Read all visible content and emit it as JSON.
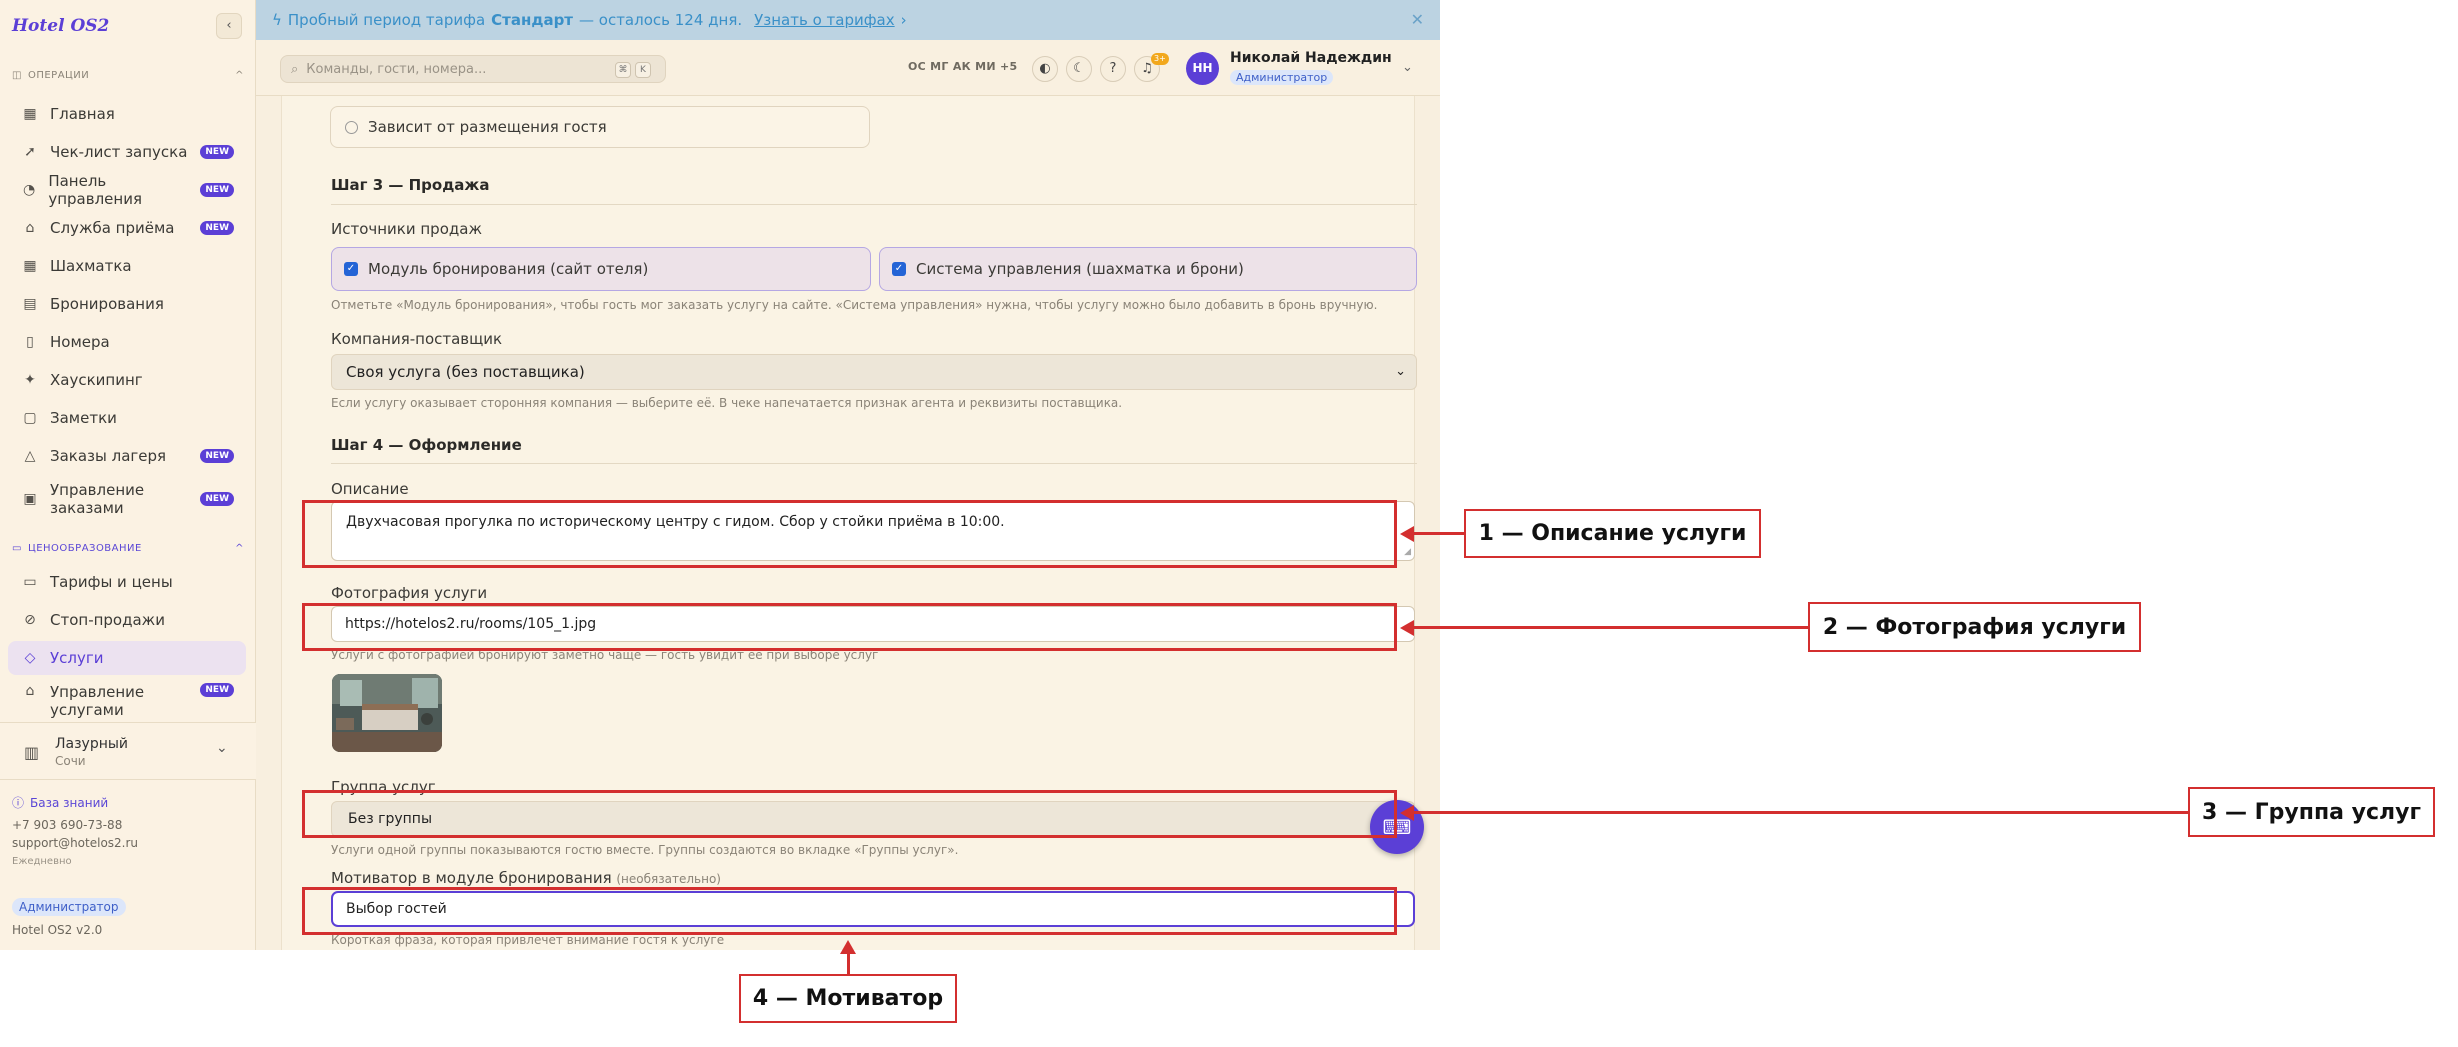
{
  "sidebar": {
    "logo": "Hotel OS2",
    "section_ops": "ОПЕРАЦИИ",
    "section_pricing": "ЦЕНООБРАЗОВАНИЕ",
    "new_badge": "NEW",
    "items": [
      {
        "label": "Главная",
        "icon": "grid-icon"
      },
      {
        "label": "Чек-лист запуска",
        "icon": "rocket-icon",
        "new": true
      },
      {
        "label": "Панель управления",
        "icon": "gauge-icon",
        "new": true
      },
      {
        "label": "Служба приёма",
        "icon": "bell-desk-icon",
        "new": true
      },
      {
        "label": "Шахматка",
        "icon": "table-icon"
      },
      {
        "label": "Бронирования",
        "icon": "clipboard-icon"
      },
      {
        "label": "Номера",
        "icon": "door-icon"
      },
      {
        "label": "Хаускипинг",
        "icon": "sparkle-icon"
      },
      {
        "label": "Заметки",
        "icon": "note-icon"
      },
      {
        "label": "Заказы лагеря",
        "icon": "tent-icon",
        "new": true
      },
      {
        "label": "Управление заказами",
        "icon": "orders-icon",
        "new": true
      },
      {
        "label": "Тарифы и цены",
        "icon": "card-icon"
      },
      {
        "label": "Стоп-продажи",
        "icon": "stop-icon"
      },
      {
        "label": "Услуги",
        "icon": "tag-icon",
        "active": true
      },
      {
        "label": "Управление услугами",
        "icon": "bell-desk-icon",
        "new": true
      }
    ],
    "hotel": {
      "name": "Лазурный",
      "city": "Сочи"
    },
    "knowledge_base": "База знаний",
    "phone": "+7 903 690-73-88",
    "email": "support@hotelos2.ru",
    "schedule": "Ежедневно",
    "role": "Администратор",
    "version": "Hotel OS2 v2.0"
  },
  "banner": {
    "prefix": "Пробный период тарифа",
    "plan": "Стандарт",
    "suffix": "— осталось 124 дня.",
    "link": "Узнать о тарифах"
  },
  "header": {
    "search_placeholder": "Команды, гости, номера...",
    "kbd1": "⌘",
    "kbd2": "K",
    "avatars": "ОС МГ АК МИ +5",
    "notif_count": "3+",
    "user_initials": "НН",
    "user_name": "Николай Надеждин",
    "user_role": "Администратор"
  },
  "form": {
    "radio_option": "Зависит от размещения гостя",
    "step3_title": "Шаг 3 — Продажа",
    "sources_label": "Источники продаж",
    "source1": "Модуль бронирования (сайт отеля)",
    "source2": "Система управления (шахматка и брони)",
    "sources_hint": "Отметьте «Модуль бронирования», чтобы гость мог заказать услугу на сайте. «Система управления» нужна, чтобы услугу можно было добавить в бронь вручную.",
    "supplier_label": "Компания-поставщик",
    "supplier_value": "Своя услуга (без поставщика)",
    "supplier_hint": "Если услугу оказывает сторонняя компания — выберите её. В чеке напечатается признак агента и реквизиты поставщика.",
    "step4_title": "Шаг 4 — Оформление",
    "desc_label": "Описание",
    "desc_value": "Двухчасовая прогулка по историческому центру с гидом. Сбор у стойки приёма в 10:00.",
    "photo_label": "Фотография услуги",
    "photo_value": "https://hotelos2.ru/rooms/105_1.jpg",
    "photo_hint": "Услуги с фотографией бронируют заметно чаще — гость увидит её при выборе услуг",
    "group_label": "Группа услуг",
    "group_value": "Без группы",
    "group_hint": "Услуги одной группы показываются гостю вместе. Группы создаются во вкладке «Группы услуг».",
    "motivator_label": "Мотиватор в модуле бронирования",
    "motivator_optional": "(необязательно)",
    "motivator_value": "Выбор гостей",
    "motivator_hint": "Короткая фраза, которая привлечет внимание гостя к услуге"
  },
  "annotations": {
    "a1": "1 — Описание услуги",
    "a2": "2 — Фотография услуги",
    "a3": "3 — Группа услуг",
    "a4": "4 — Мотиватор"
  },
  "colors": {
    "accent": "#5b3fd6",
    "annotation": "#d32f2f"
  }
}
